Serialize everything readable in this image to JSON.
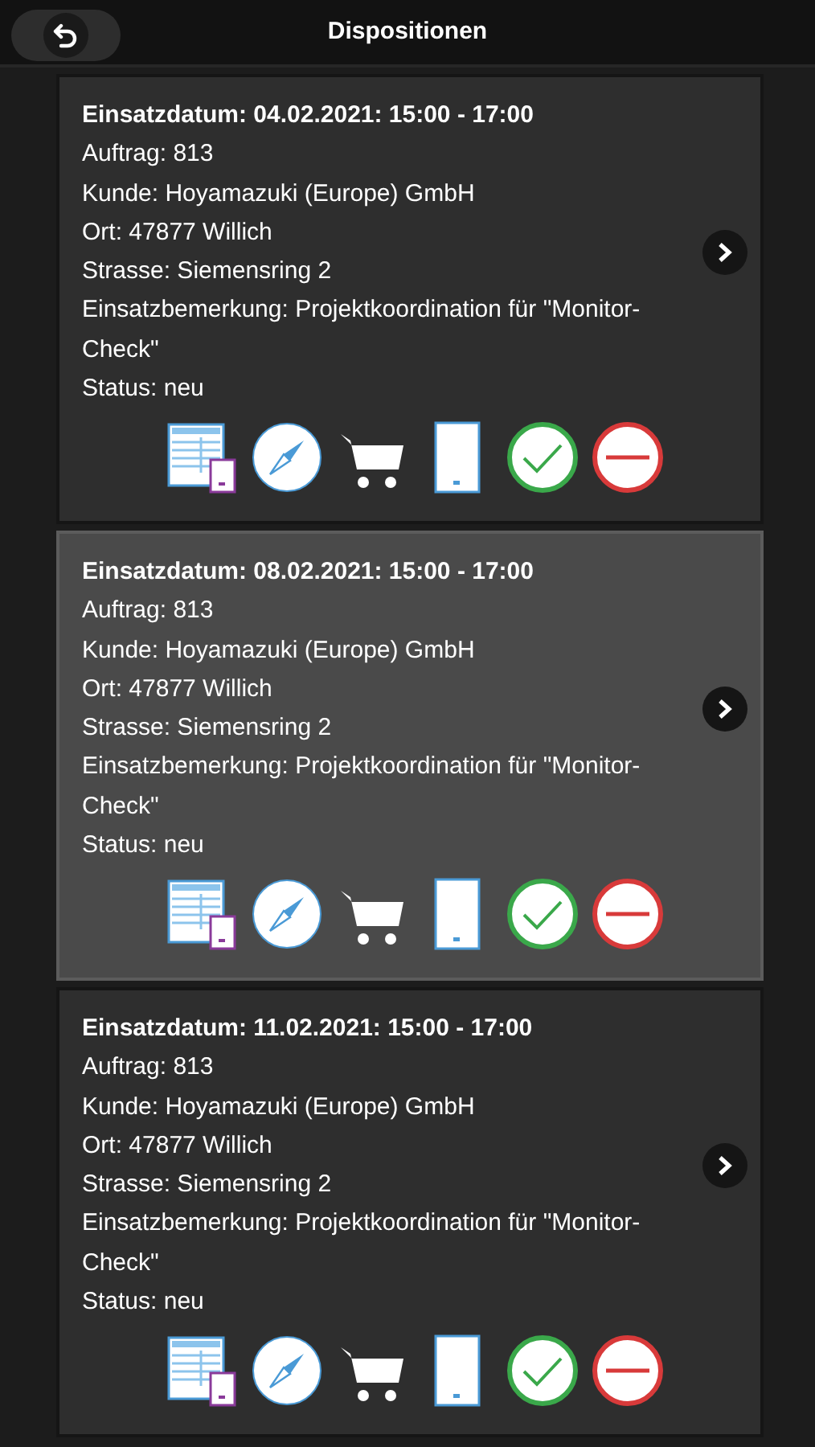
{
  "header": {
    "title": "Dispositionen"
  },
  "cards": [
    {
      "selected": false,
      "heading": "Einsatzdatum: 04.02.2021: 15:00 - 17:00",
      "lines": [
        "Auftrag: 813",
        "Kunde: Hoyamazuki (Europe) GmbH",
        "Ort: 47877 Willich",
        "Strasse: Siemensring 2",
        "Einsatzbemerkung: Projektkoordination für \"Monitor-Check\"",
        "Status: neu"
      ],
      "actions": [
        {
          "kind": "form"
        },
        {
          "kind": "compass"
        },
        {
          "kind": "cart"
        },
        {
          "kind": "device"
        },
        {
          "kind": "accept"
        },
        {
          "kind": "reject"
        }
      ]
    },
    {
      "selected": true,
      "heading": "Einsatzdatum: 08.02.2021: 15:00 - 17:00",
      "lines": [
        "Auftrag: 813",
        "Kunde: Hoyamazuki (Europe) GmbH",
        "Ort: 47877 Willich",
        "Strasse: Siemensring 2",
        "Einsatzbemerkung: Projektkoordination für \"Monitor-Check\"",
        "Status: neu"
      ],
      "actions": [
        {
          "kind": "form"
        },
        {
          "kind": "compass"
        },
        {
          "kind": "cart"
        },
        {
          "kind": "device"
        },
        {
          "kind": "accept"
        },
        {
          "kind": "reject"
        }
      ]
    },
    {
      "selected": false,
      "heading": "Einsatzdatum: 11.02.2021: 15:00 - 17:00",
      "lines": [
        "Auftrag: 813",
        "Kunde: Hoyamazuki (Europe) GmbH",
        "Ort: 47877 Willich",
        "Strasse: Siemensring 2",
        "Einsatzbemerkung: Projektkoordination für \"Monitor-Check\"",
        "Status: neu"
      ],
      "actions": [
        {
          "kind": "form"
        },
        {
          "kind": "compass"
        },
        {
          "kind": "cart"
        },
        {
          "kind": "device"
        },
        {
          "kind": "accept"
        },
        {
          "kind": "reject"
        }
      ]
    }
  ]
}
